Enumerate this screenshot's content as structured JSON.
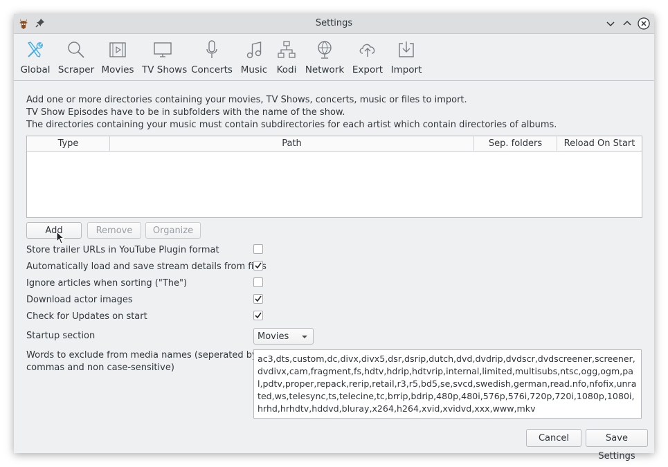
{
  "window": {
    "title": "Settings"
  },
  "toolbar": {
    "items": [
      {
        "label": "Global",
        "icon": "tools-icon"
      },
      {
        "label": "Scraper",
        "icon": "search-icon"
      },
      {
        "label": "Movies",
        "icon": "film-icon"
      },
      {
        "label": "TV Shows",
        "icon": "monitor-icon"
      },
      {
        "label": "Concerts",
        "icon": "microphone-icon"
      },
      {
        "label": "Music",
        "icon": "music-note-icon"
      },
      {
        "label": "Kodi",
        "icon": "network-tree-icon"
      },
      {
        "label": "Network",
        "icon": "globe-icon"
      },
      {
        "label": "Export",
        "icon": "cloud-upload-icon"
      },
      {
        "label": "Import",
        "icon": "download-icon"
      }
    ]
  },
  "intro": {
    "line1": "Add one or more directories containing your movies, TV Shows, concerts, music or files to import.",
    "line2": "TV Show Episodes have to be in subfolders with the name of the show.",
    "line3": "The directories containing your music must contain subdirectories for each artist which contain directories of albums."
  },
  "directories_table": {
    "columns": [
      "Type",
      "Path",
      "Sep. folders",
      "Reload On Start"
    ],
    "rows": []
  },
  "dir_buttons": {
    "add": "Add",
    "remove": "Remove",
    "organize": "Organize"
  },
  "options": [
    {
      "label": "Store trailer URLs in YouTube Plugin format",
      "checked": false
    },
    {
      "label": "Automatically load and save stream details from files",
      "checked": true
    },
    {
      "label": "Ignore articles when sorting (\"The\")",
      "checked": false
    },
    {
      "label": "Download actor images",
      "checked": true
    },
    {
      "label": "Check for Updates on start",
      "checked": true
    }
  ],
  "startup": {
    "label": "Startup section",
    "value": "Movies"
  },
  "exclude": {
    "label_line1": "Words to exclude from media names (seperated by",
    "label_line2": "commas and non case-sensitive)",
    "value": "ac3,dts,custom,dc,divx,divx5,dsr,dsrip,dutch,dvd,dvdrip,dvdscr,dvdscreener,screener,dvdivx,cam,fragment,fs,hdtv,hdrip,hdtvrip,internal,limited,multisubs,ntsc,ogg,ogm,pal,pdtv,proper,repack,rerip,retail,r3,r5,bd5,se,svcd,swedish,german,read.nfo,nfofix,unrated,ws,telesync,ts,telecine,tc,brrip,bdrip,480p,480i,576p,576i,720p,720i,1080p,1080i,hrhd,hrhdtv,hddvd,bluray,x264,h264,xvid,xvidvd,xxx,www,mkv"
  },
  "footer": {
    "cancel": "Cancel",
    "save": "Save Settings"
  },
  "colors": {
    "accent": "#3daee9",
    "window_bg": "#eff0f1",
    "text": "#31363b"
  }
}
